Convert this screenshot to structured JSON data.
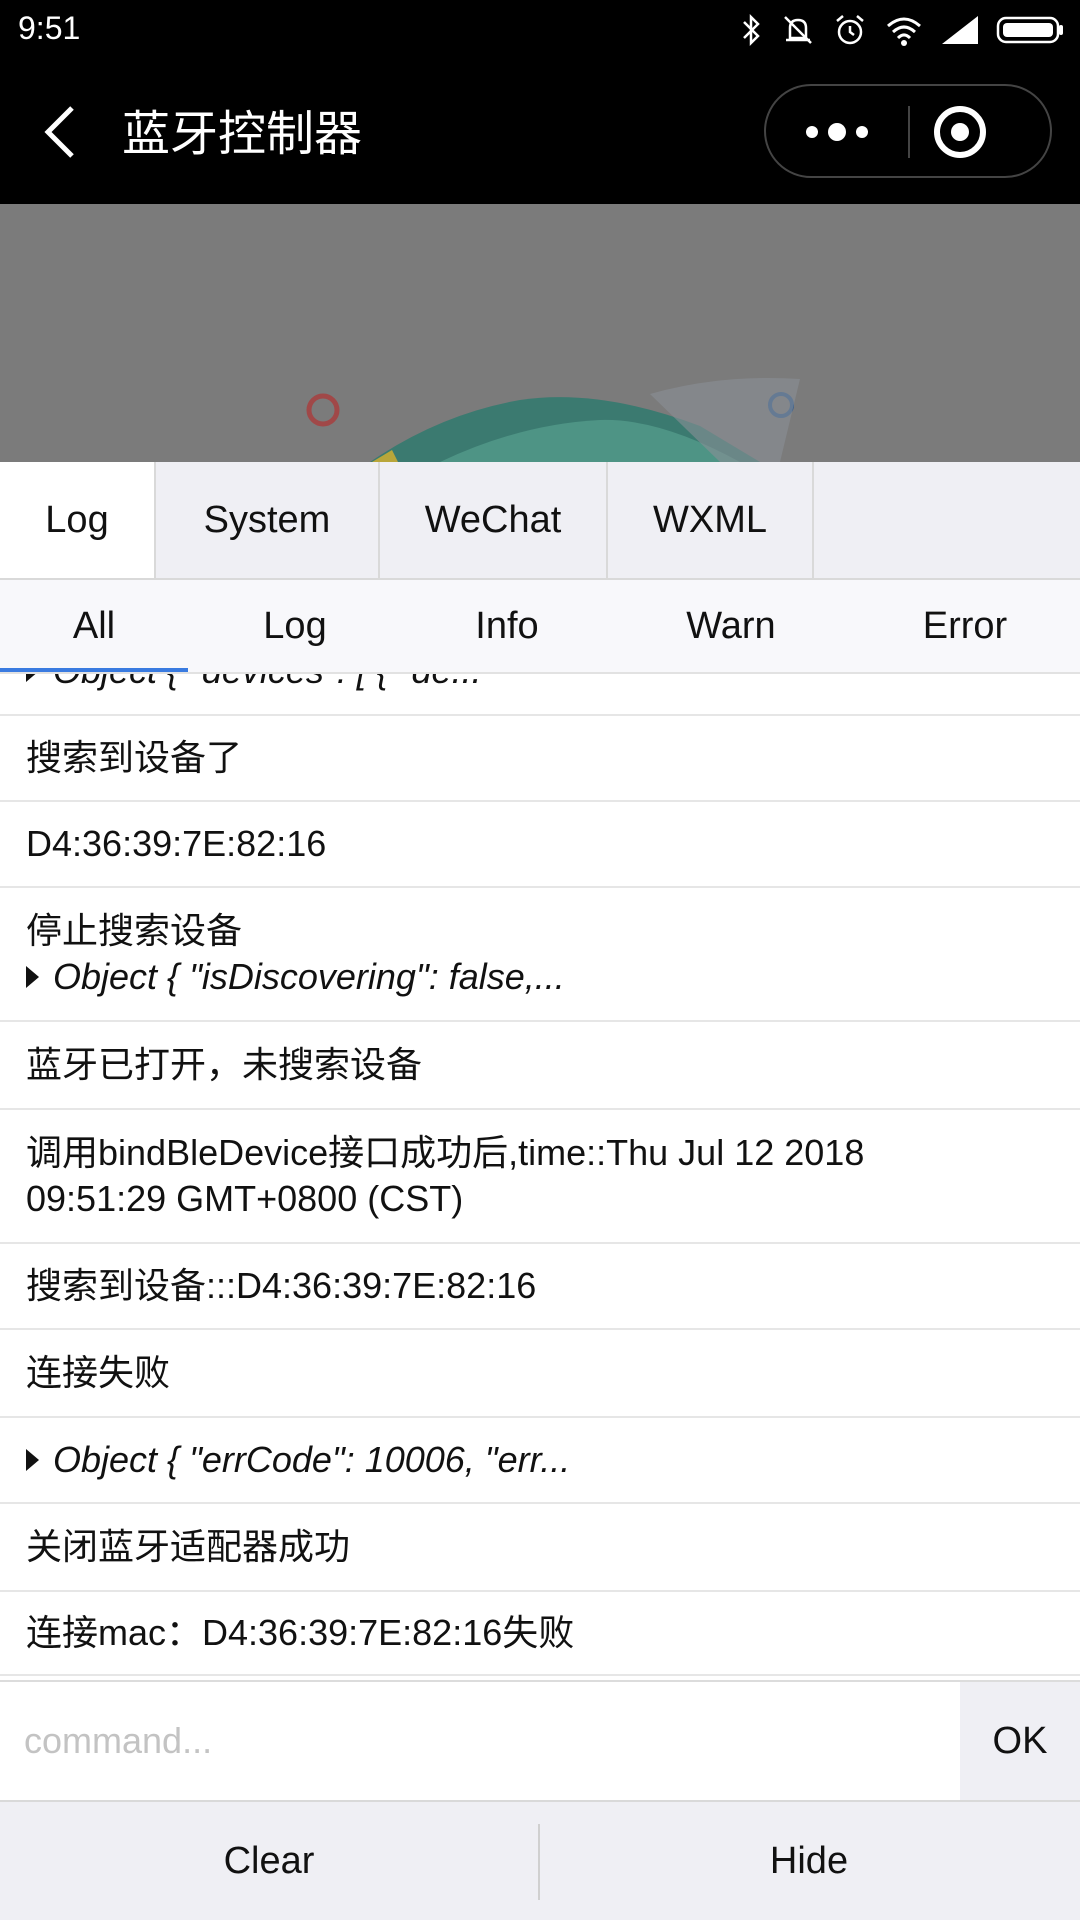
{
  "status_bar": {
    "time": "9:51",
    "icons": [
      "bluetooth-icon",
      "mute-icon",
      "alarm-icon",
      "wifi-icon",
      "signal-icon",
      "battery-icon"
    ]
  },
  "nav": {
    "title": "蓝牙控制器",
    "back_icon": "chevron-left-icon",
    "more_icon": "more-dots-icon",
    "close_icon": "miniprogram-close-icon"
  },
  "console": {
    "tabs": [
      {
        "label": "Log",
        "active": true
      },
      {
        "label": "System",
        "active": false
      },
      {
        "label": "WeChat",
        "active": false
      },
      {
        "label": "WXML",
        "active": false
      }
    ],
    "filters": [
      {
        "label": "All",
        "active": true
      },
      {
        "label": "Log",
        "active": false
      },
      {
        "label": "Info",
        "active": false
      },
      {
        "label": "Warn",
        "active": false
      },
      {
        "label": "Error",
        "active": false
      }
    ],
    "logs": [
      {
        "object": "Object { \"devices\": [ { \"de..."
      },
      {
        "text": "搜索到设备了"
      },
      {
        "text": "D4:36:39:7E:82:16"
      },
      {
        "text": "停止搜索设备",
        "object": "Object { \"isDiscovering\": false,..."
      },
      {
        "text": "蓝牙已打开，未搜索设备"
      },
      {
        "text": "调用bindBleDevice接口成功后,time::Thu Jul 12 2018",
        "text2": "09:51:29 GMT+0800 (CST)"
      },
      {
        "text": "搜索到设备:::D4:36:39:7E:82:16"
      },
      {
        "text": "连接失败"
      },
      {
        "object": "Object { \"errCode\": 10006, \"err..."
      },
      {
        "text": "关闭蓝牙适配器成功"
      },
      {
        "text": "连接mac：D4:36:39:7E:82:16失败"
      }
    ],
    "command": {
      "placeholder": "command...",
      "value": "",
      "ok_label": "OK"
    },
    "toolbar": {
      "clear_label": "Clear",
      "hide_label": "Hide"
    }
  },
  "colors": {
    "accent": "#3a7be0",
    "panel_bg": "#efeff4",
    "overlay": "#7b7b7b"
  }
}
